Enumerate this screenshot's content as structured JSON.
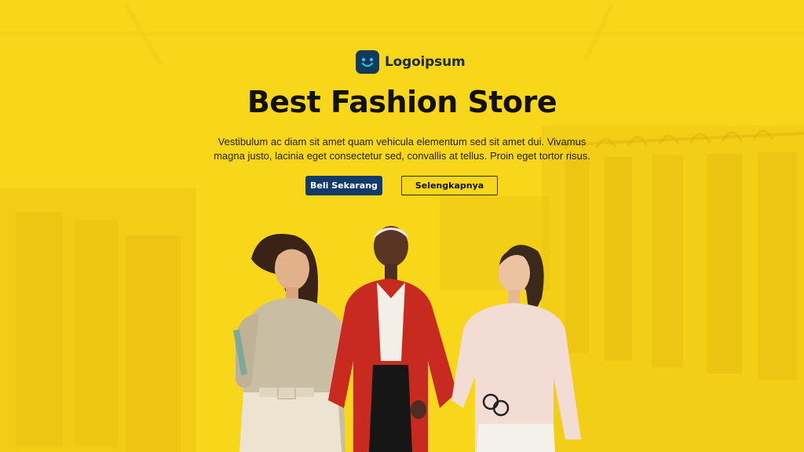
{
  "brand": {
    "name": "Logoipsum",
    "logo_icon": "smile-face-icon"
  },
  "hero": {
    "title": "Best Fashion Store",
    "description": "Vestibulum ac diam sit amet quam vehicula elementum sed sit amet dui. Vivamus magna justo, lacinia eget consectetur sed, convallis at tellus. Proin eget tortor risus.",
    "primary_button": "Beli Sekarang",
    "secondary_button": "Selengkapnya"
  },
  "colors": {
    "background": "#f8d61a",
    "primary_button": "#123a6a",
    "logo_mark": "#123a5c",
    "title": "#111111"
  }
}
